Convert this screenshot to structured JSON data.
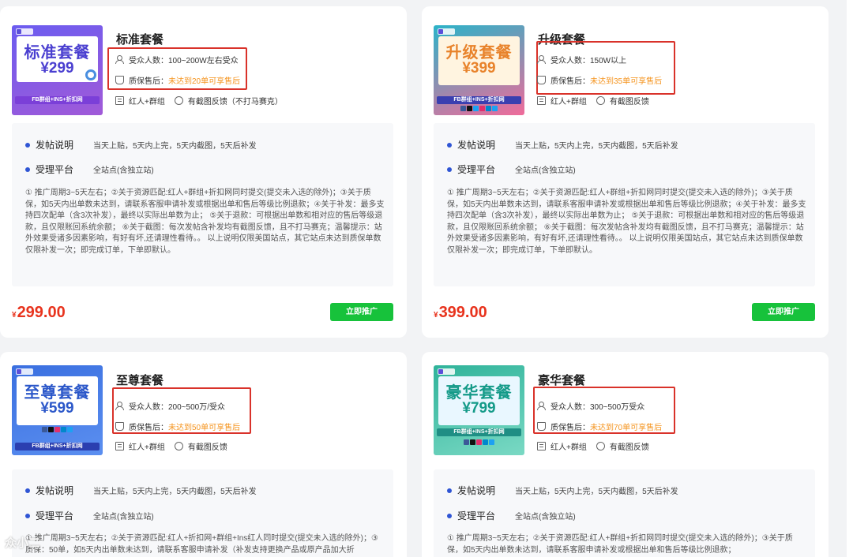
{
  "cards": [
    {
      "name": "标准套餐",
      "thumb": {
        "title": "标准套餐",
        "price": "¥299",
        "band": "FB群组+INS+折扣网",
        "bg": "#5b4fd9",
        "panel": "#ffffff",
        "text": "#4a3fd0"
      },
      "audience_label": "受众人数：",
      "audience_value": "100~200W左右受众",
      "warranty_label": "质保售后：",
      "warranty_value": "未达到20单可享售后",
      "resources": "红人+群组",
      "feedback": "有截图反馈（不打马赛克）",
      "post_label": "发帖说明",
      "post_value": "当天上贴，5天内上完，5天内截图，5天后补发",
      "platform_label": "受理平台",
      "platform_value": "全站点(含独立站)",
      "description": "① 推广周期3~5天左右；②关于资源匹配:红人+群组+折扣网同时提交(提交未入选的除外)；③关于质保，如5天内出单数未达到，请联系客服申请补发或根据出单和售后等级比例退款；④关于补发：最多支持四次配单（含3次补发），最终以实际出单数为止； ⑤关于退款：可根据出单数和相对应的售后等级退款，且仅限账回系统余额； ⑥关于截图：每次发帖含补发均有截图反馈，且不打马赛克；温馨提示：站外效果受诸多因素影响，有好有坏,还请理性看待。。 以上说明仅限美国站点，其它站点未达到质保单数仅限补发一次；即完成订单，下单即默认。",
      "price_symbol": "¥",
      "price": "299.00",
      "button": "立即推广"
    },
    {
      "name": "升级套餐",
      "thumb": {
        "title": "升级套餐",
        "price": "¥399",
        "band": "FB群组+INS+折扣网",
        "bg": "#2bb3c8",
        "panel": "#fff4e0",
        "text": "#e8822a"
      },
      "audience_label": "受众人数：",
      "audience_value": "150W以上",
      "warranty_label": "质保售后：",
      "warranty_value": "未达到35单可享售后",
      "resources": "红人+群组",
      "feedback": "有截图反馈",
      "post_label": "发帖说明",
      "post_value": "当天上贴，5天内上完，5天内截图，5天后补发",
      "platform_label": "受理平台",
      "platform_value": "全站点(含独立站)",
      "description": "① 推广周期3~5天左右；②关于资源匹配:红人+群组+折扣网同时提交(提交未入选的除外)；③关于质保，如5天内出单数未达到，请联系客服申请补发或根据出单和售后等级比例退款；④关于补发：最多支持四次配单（含3次补发），最终以实际出单数为止； ⑤关于退款：可根据出单数和相对应的售后等级退款，且仅限账回系统余额； ⑥关于截图：每次发帖含补发均有截图反馈，且不打马赛克；温馨提示：站外效果受诸多因素影响，有好有坏,还请理性看待。。 以上说明仅限美国站点，其它站点未达到质保单数仅限补发一次；即完成订单，下单即默认。",
      "price_symbol": "¥",
      "price": "399.00",
      "button": "立即推广"
    },
    {
      "name": "至尊套餐",
      "thumb": {
        "title": "至尊套餐",
        "price": "¥599",
        "band": "FB群组+INS+折扣网",
        "bg": "#3a6fe0",
        "panel": "#ffffff",
        "text": "#2b57c9"
      },
      "audience_label": "受众人数：",
      "audience_value": "200~500万/受众",
      "warranty_label": "质保售后：",
      "warranty_value": "未达到50单可享售后",
      "resources": "红人+群组",
      "feedback": "有截图反馈",
      "post_label": "发帖说明",
      "post_value": "当天上贴，5天内上完，5天内截图，5天后补发",
      "platform_label": "受理平台",
      "platform_value": "全站点(含独立站)",
      "description": "① 推广周期3~5天左右；②关于资源匹配:红人+折扣网+群组+Ins红人同时提交(提交未入选的除外)；③质保：50单，如5天内出单数未达到，请联系客服申请补发（补发支持更换产品或原产品加大折",
      "price_symbol": "",
      "price": "",
      "button": ""
    },
    {
      "name": "豪华套餐",
      "thumb": {
        "title": "豪华套餐",
        "price": "¥799",
        "band": "FB群组+INS+折扣网",
        "bg": "#2fb39a",
        "panel": "#e9f7ff",
        "text": "#139a88"
      },
      "audience_label": "受众人数：",
      "audience_value": "300~500万受众",
      "warranty_label": "质保售后：",
      "warranty_value": "未达到70单可享售后",
      "resources": "红人+群组",
      "feedback": "有截图反馈",
      "post_label": "发帖说明",
      "post_value": "当天上贴，5天内上完，5天内截图，5天后补发",
      "platform_label": "受理平台",
      "platform_value": "全站点(含独立站)",
      "description": "① 推广周期3~5天左右；②关于资源匹配:红人+群组+折扣网同时提交(提交未入选的除外)；③关于质保，如5天内出单数未达到，请联系客服申请补发或根据出单和售后等级比例退款；",
      "price_symbol": "",
      "price": "",
      "button": ""
    }
  ],
  "watermark": "众小二",
  "colors": {
    "price": "#e8331d",
    "button": "#17c23b",
    "highlight": "#f5941f",
    "annotation": "#d9322a",
    "bullet": "#2f55d4"
  }
}
